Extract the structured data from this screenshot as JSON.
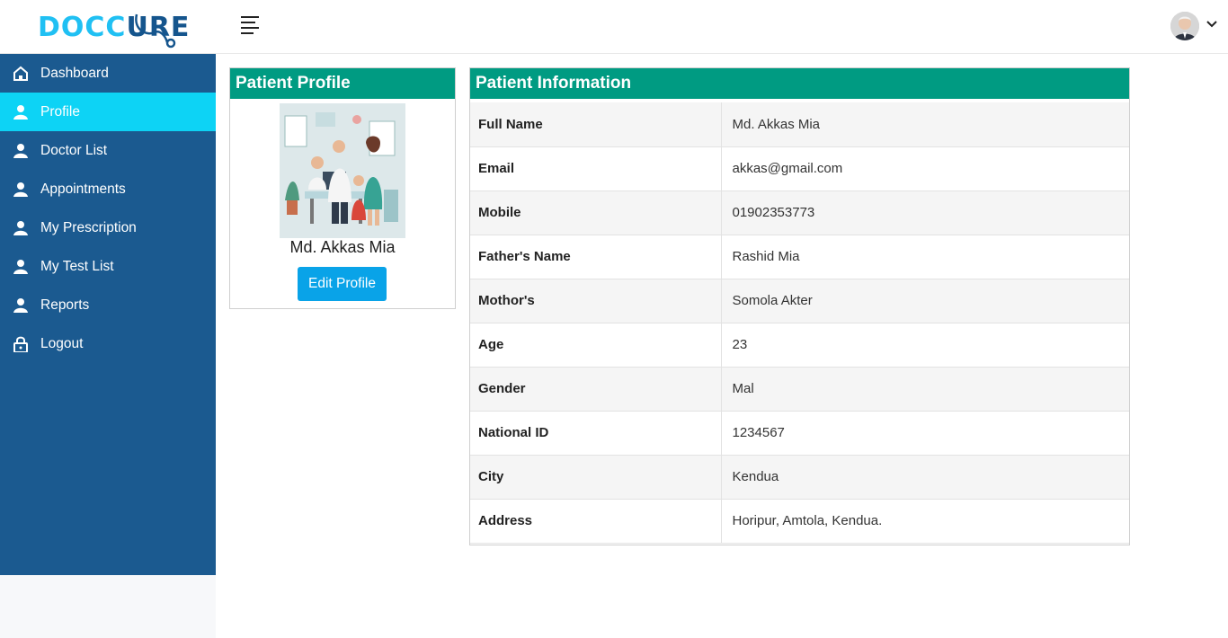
{
  "brand": {
    "part1": "DOCC",
    "part2": "URE"
  },
  "sidebar": {
    "items": [
      {
        "label": "Dashboard",
        "icon": "home-icon",
        "active": false
      },
      {
        "label": "Profile",
        "icon": "user-icon",
        "active": true
      },
      {
        "label": "Doctor List",
        "icon": "user-icon",
        "active": false
      },
      {
        "label": "Appointments",
        "icon": "user-icon",
        "active": false
      },
      {
        "label": "My Prescription",
        "icon": "user-icon",
        "active": false
      },
      {
        "label": "My Test List",
        "icon": "user-icon",
        "active": false
      },
      {
        "label": "Reports",
        "icon": "user-icon",
        "active": false
      },
      {
        "label": "Logout",
        "icon": "lock-icon",
        "active": false
      }
    ]
  },
  "profile_card": {
    "title": "Patient Profile",
    "name": "Md. Akkas Mia",
    "edit_label": "Edit Profile"
  },
  "info_card": {
    "title": "Patient Information",
    "rows": [
      {
        "label": "Full Name",
        "value": "Md. Akkas Mia"
      },
      {
        "label": "Email",
        "value": "akkas@gmail.com"
      },
      {
        "label": "Mobile",
        "value": "01902353773"
      },
      {
        "label": "Father's Name",
        "value": "Rashid Mia"
      },
      {
        "label": "Mothor's",
        "value": "Somola Akter"
      },
      {
        "label": "Age",
        "value": "23"
      },
      {
        "label": "Gender",
        "value": "Mal"
      },
      {
        "label": "National ID",
        "value": "1234567"
      },
      {
        "label": "City",
        "value": "Kendua"
      },
      {
        "label": "Address",
        "value": "Horipur, Amtola, Kendua."
      }
    ]
  },
  "colors": {
    "sidebar": "#1b5a90",
    "active_nav": "#0dd3f5",
    "card_header": "#009b82",
    "button": "#09a3e8",
    "brand_light": "#20c0f3",
    "brand_dark": "#15558d"
  }
}
